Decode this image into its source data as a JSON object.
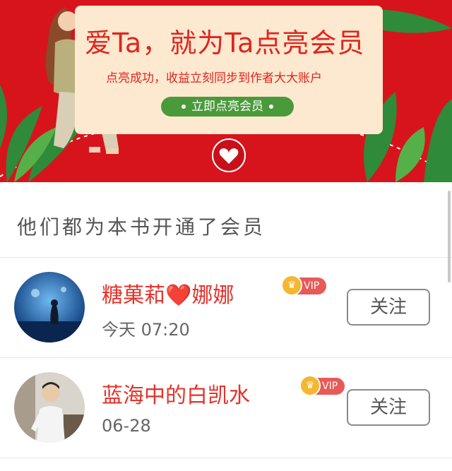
{
  "banner": {
    "title": "爱Ta，就为Ta点亮会员",
    "subtitle": "点亮成功，收益立刻同步到作者大大账户",
    "button_label": "立即点亮会员",
    "colors": {
      "background": "#d7141c",
      "card": "#fde9cf",
      "button": "#4a9a3c"
    }
  },
  "section": {
    "title": "他们都为本书开通了会员"
  },
  "members": [
    {
      "name": "糖菓萂❤️娜娜",
      "badge": "VIP",
      "time": "今天 07:20",
      "follow_label": "关注",
      "avatar_icon": "aquarium-photo-avatar"
    },
    {
      "name": "蓝海中的白凯水",
      "badge": "VIP",
      "time": "06-28",
      "follow_label": "关注",
      "avatar_icon": "person-photo-avatar"
    }
  ]
}
